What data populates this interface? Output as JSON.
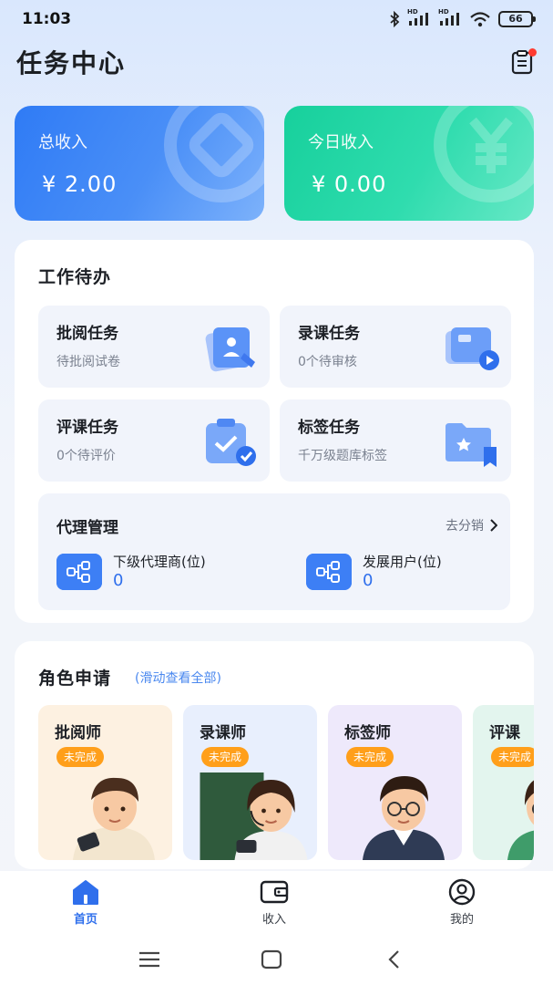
{
  "status_bar": {
    "time": "11:03",
    "hd1": "HD",
    "hd2": "HD",
    "battery": "66"
  },
  "header": {
    "title": "任务中心",
    "icon": "clipboard-icon"
  },
  "income": {
    "total_label": "总收入",
    "total_value": "¥ 2.00",
    "today_label": "今日收入",
    "today_value": "¥ 0.00"
  },
  "work": {
    "title": "工作待办",
    "tasks": [
      {
        "title": "批阅任务",
        "sub": "待批阅试卷",
        "icon": "review-paper-icon"
      },
      {
        "title": "录课任务",
        "sub": "0个待审核",
        "icon": "video-record-icon"
      },
      {
        "title": "评课任务",
        "sub": "0个待评价",
        "icon": "evaluate-clipboard-icon"
      },
      {
        "title": "标签任务",
        "sub": "千万级题库标签",
        "icon": "tag-folder-icon"
      }
    ],
    "agent": {
      "title": "代理管理",
      "link": "去分销",
      "stats": [
        {
          "label": "下级代理商(位)",
          "value": "0"
        },
        {
          "label": "发展用户(位)",
          "value": "0"
        }
      ]
    }
  },
  "roles": {
    "title": "角色申请",
    "hint": "(滑动查看全部)",
    "items": [
      {
        "name": "批阅师",
        "badge": "未完成",
        "bg": "#fdf1e1"
      },
      {
        "name": "录课师",
        "badge": "未完成",
        "bg": "#e8effd"
      },
      {
        "name": "标签师",
        "badge": "未完成",
        "bg": "#eee9fb"
      },
      {
        "name": "评课",
        "badge": "未完成",
        "bg": "#e3f5ee"
      }
    ]
  },
  "tabbar": [
    {
      "label": "首页",
      "icon": "home-icon",
      "active": true
    },
    {
      "label": "收入",
      "icon": "wallet-icon",
      "active": false
    },
    {
      "label": "我的",
      "icon": "profile-icon",
      "active": false
    }
  ],
  "colors": {
    "accent": "#2f6fec",
    "badge": "#ff9f1a",
    "total_card": "#2f7bf5",
    "today_card": "#17d09c"
  }
}
